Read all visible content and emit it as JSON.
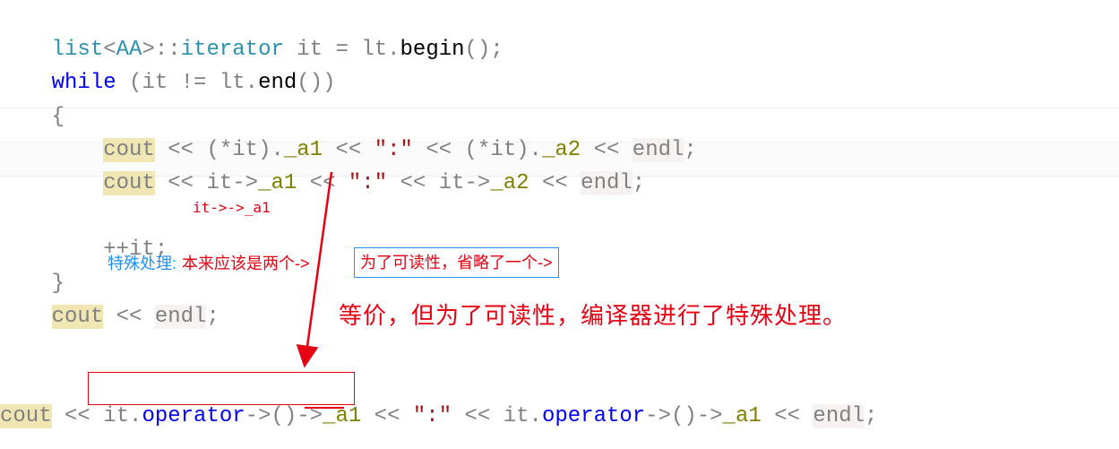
{
  "code": {
    "line1": {
      "list": "list",
      "lt": "<",
      "AA": "AA",
      "gt": ">::",
      "iterator": "iterator",
      "sp1": " ",
      "it": "it",
      "eq": " = ",
      "ltvar": "lt",
      "dot": ".",
      "begin": "begin",
      "par": "();"
    },
    "line2": {
      "while": "while",
      "sp": " (",
      "it": "it",
      "neq": " != ",
      "ltvar": "lt",
      "dot": ".",
      "end": "end",
      "par": "())"
    },
    "line3": {
      "brace": "{"
    },
    "line4": {
      "cout": "cout",
      "lsh1": " << (*",
      "it1": "it",
      "dot1": ").",
      "a1": "_a1",
      "lsh2": " << ",
      "str": "\":\"",
      "lsh3": " << (*",
      "it2": "it",
      "dot2": ").",
      "a2": "_a2",
      "lsh4": " << ",
      "endl": "endl",
      "semi": ";"
    },
    "line5": {
      "cout": "cout",
      "lsh1": " << ",
      "it1": "it",
      "arr1": "->",
      "a1": "_a1",
      "lsh2": " << ",
      "str": "\":\"",
      "lsh3": " << ",
      "it2": "it",
      "arr2": "->",
      "a2": "_a2",
      "lsh4": " << ",
      "endl": "endl",
      "semi": ";"
    },
    "line7": {
      "inc": "++",
      "it": "it",
      "semi": ";"
    },
    "line8": {
      "brace": "}"
    },
    "line9": {
      "cout": "cout",
      "lsh": " << ",
      "endl": "endl",
      "semi": ";"
    },
    "line11": {
      "cout": "cout",
      "lsh1": " << ",
      "it1": "it",
      "dot1": ".",
      "oper1": "operator",
      "arr1": "->()->",
      "a1": "_a1",
      "lsh2": " << ",
      "str": "\":\"",
      "lsh3": " << ",
      "it2": "it",
      "dot2": ".",
      "oper2": "operator",
      "arr2": "->()->",
      "a2": "_a1",
      "lsh4": " << ",
      "endl": "endl",
      "semi": ";"
    }
  },
  "annotations": {
    "small_arrow_label": "it->->_a1",
    "special_note_label": "特殊处理:",
    "special_note_red": "本来应该是两个->",
    "blue_box_text": "为了可读性，省略了一个->",
    "big_red": "等价，但为了可读性，编译器进行了特殊处理。"
  }
}
